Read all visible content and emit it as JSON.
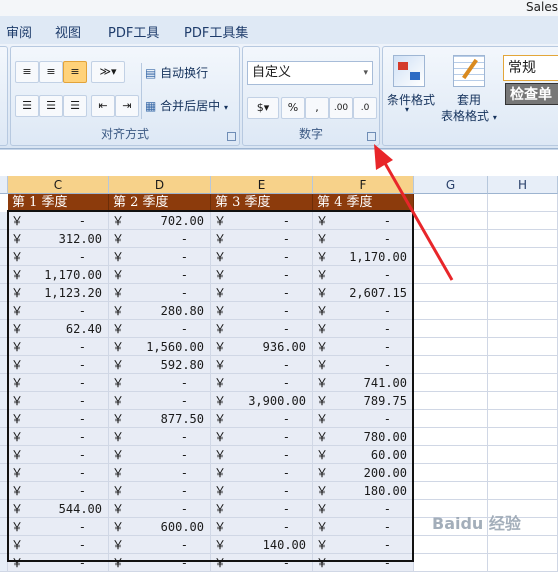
{
  "window": {
    "title": "Sales"
  },
  "tabs": [
    "审阅",
    "视图",
    "PDF工具",
    "PDF工具集"
  ],
  "ribbon": {
    "alignment": {
      "label": "对齐方式",
      "wrap_text": "自动换行",
      "merge_center": "合并后居中"
    },
    "number": {
      "label": "数字",
      "format_value": "自定义",
      "percent": "%",
      "comma": ",",
      "inc_decimal": ".00",
      "dec_decimal": ".0"
    },
    "styles": {
      "conditional_format": "条件格式",
      "table_format_line1": "套用",
      "table_format_line2": "表格格式",
      "style_normal": "常规",
      "style_check": "检查单"
    }
  },
  "sheet": {
    "columns": [
      "C",
      "D",
      "E",
      "F",
      "G",
      "H"
    ],
    "headers": [
      "第 1 季度",
      "第 2 季度",
      "第 3 季度",
      "第 4 季度"
    ],
    "currency_symbol": "￥",
    "rows": [
      [
        "-",
        "702.00",
        "-",
        "-"
      ],
      [
        "312.00",
        "-",
        "-",
        "-"
      ],
      [
        "-",
        "-",
        "-",
        "1,170.00"
      ],
      [
        "1,170.00",
        "-",
        "-",
        "-"
      ],
      [
        "1,123.20",
        "-",
        "-",
        "2,607.15"
      ],
      [
        "-",
        "280.80",
        "-",
        "-"
      ],
      [
        "62.40",
        "-",
        "-",
        "-"
      ],
      [
        "-",
        "1,560.00",
        "936.00",
        "-"
      ],
      [
        "-",
        "592.80",
        "-",
        "-"
      ],
      [
        "-",
        "-",
        "-",
        "741.00"
      ],
      [
        "-",
        "-",
        "3,900.00",
        "789.75"
      ],
      [
        "-",
        "877.50",
        "-",
        "-"
      ],
      [
        "-",
        "-",
        "-",
        "780.00"
      ],
      [
        "-",
        "-",
        "-",
        "60.00"
      ],
      [
        "-",
        "-",
        "-",
        "200.00"
      ],
      [
        "-",
        "-",
        "-",
        "180.00"
      ],
      [
        "544.00",
        "-",
        "-",
        "-"
      ],
      [
        "-",
        "600.00",
        "-",
        "-"
      ],
      [
        "-",
        "-",
        "140.00",
        "-"
      ],
      [
        "-",
        "-",
        "-",
        "-"
      ]
    ]
  },
  "colors": {
    "header_fill": "#8c3b0c",
    "data_fill": "#e8ecf5",
    "arrow": "#e8262a"
  },
  "watermark": "Baidu 经验"
}
